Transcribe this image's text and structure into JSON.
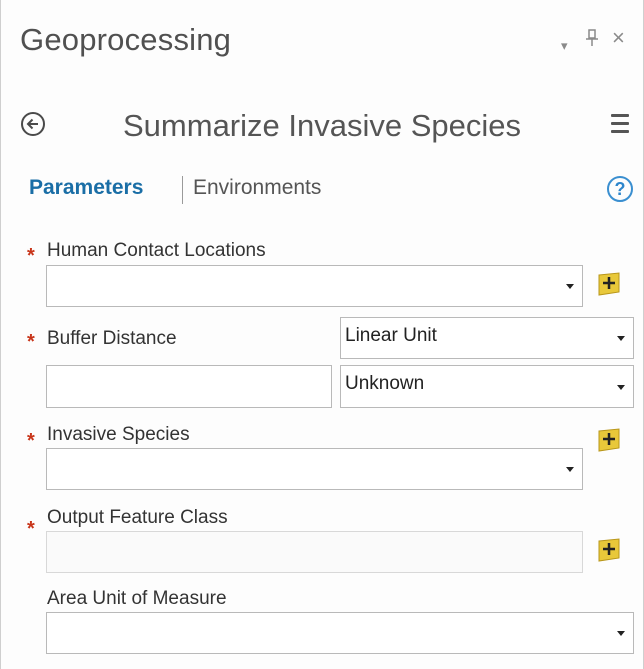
{
  "pane": {
    "title": "Geoprocessing",
    "controls": {
      "menu": "▾",
      "pin": "⊥",
      "close": "×"
    }
  },
  "tool": {
    "title": "Summarize Invasive Species"
  },
  "tabs": {
    "parameters": "Parameters",
    "environments": "Environments",
    "help": "?"
  },
  "required_marker": "*",
  "params": {
    "human_contact": {
      "label": "Human Contact Locations",
      "value": ""
    },
    "buffer_distance": {
      "label": "Buffer Distance",
      "value": "",
      "unit_type": "Linear Unit",
      "unit": "Unknown"
    },
    "invasive_species": {
      "label": "Invasive Species",
      "value": ""
    },
    "output_fc": {
      "label": "Output Feature Class",
      "value": ""
    },
    "area_unit": {
      "label": "Area Unit of Measure",
      "value": ""
    }
  },
  "colors": {
    "accent": "#1a6ea6",
    "required": "#c8351a",
    "add_icon": "#e8c83a"
  }
}
